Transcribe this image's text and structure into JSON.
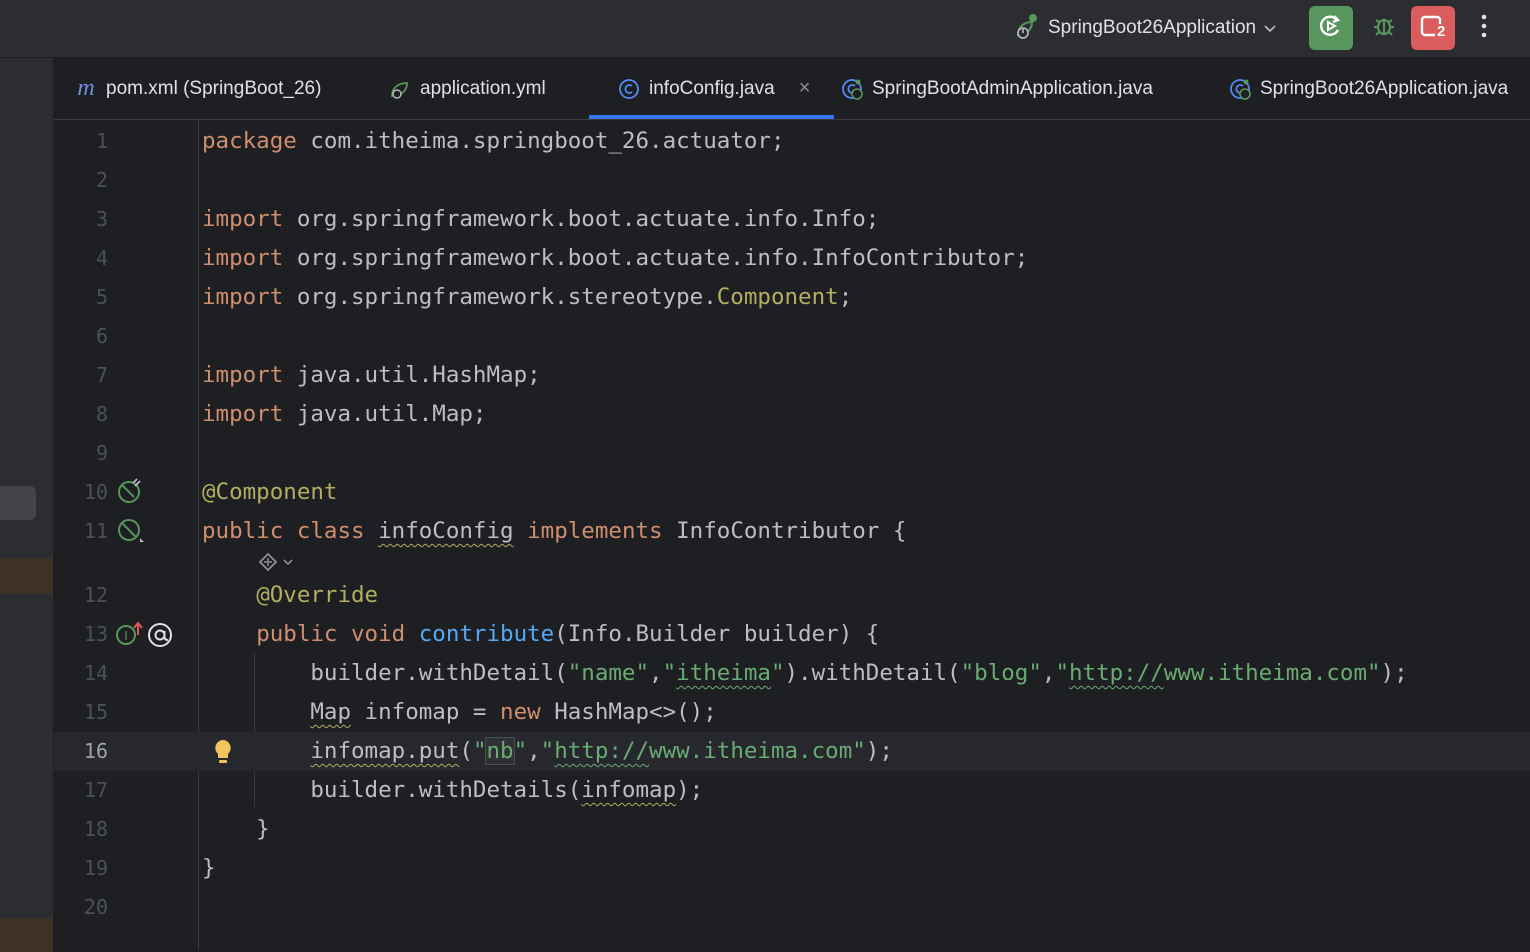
{
  "toolbar": {
    "run_config": "SpringBoot26Application",
    "icons": [
      "run-config-icon",
      "chevron-down-icon",
      "rerun-icon",
      "debug-icon",
      "stop-icon",
      "more-icon"
    ],
    "stop_badge": "2"
  },
  "tabs": [
    {
      "label": "pom.xml (SpringBoot_26)",
      "icon": "maven-icon",
      "active": false
    },
    {
      "label": "application.yml",
      "icon": "yaml-spring-icon",
      "active": false
    },
    {
      "label": "infoConfig.java",
      "icon": "java-class-icon",
      "active": true
    },
    {
      "label": "SpringBootAdminApplication.java",
      "icon": "spring-app-icon",
      "active": false
    },
    {
      "label": "SpringBoot26Application.java",
      "icon": "spring-app-icon",
      "active": false
    }
  ],
  "editor": {
    "line_numbers": [
      "1",
      "2",
      "3",
      "4",
      "5",
      "6",
      "7",
      "8",
      "9",
      "10",
      "11",
      "12",
      "13",
      "14",
      "15",
      "16",
      "17",
      "18",
      "19",
      "20"
    ],
    "current_line": "16",
    "lines": [
      "package com.itheima.springboot_26.actuator;",
      "",
      "import org.springframework.boot.actuate.info.Info;",
      "import org.springframework.boot.actuate.info.InfoContributor;",
      "import org.springframework.stereotype.Component;",
      "",
      "import java.util.HashMap;",
      "import java.util.Map;",
      "",
      "@Component",
      "public class infoConfig implements InfoContributor {",
      "    @Override",
      "    public void contribute(Info.Builder builder) {",
      "        builder.withDetail(\"name\",\"itheima\").withDetail(\"blog\",\"http://www.itheima.com\");",
      "        Map infomap = new HashMap<>();",
      "        infomap.put(\"nb\",\"http://www.itheima.com\");",
      "        builder.withDetails(infomap);",
      "    }",
      "}",
      ""
    ]
  }
}
